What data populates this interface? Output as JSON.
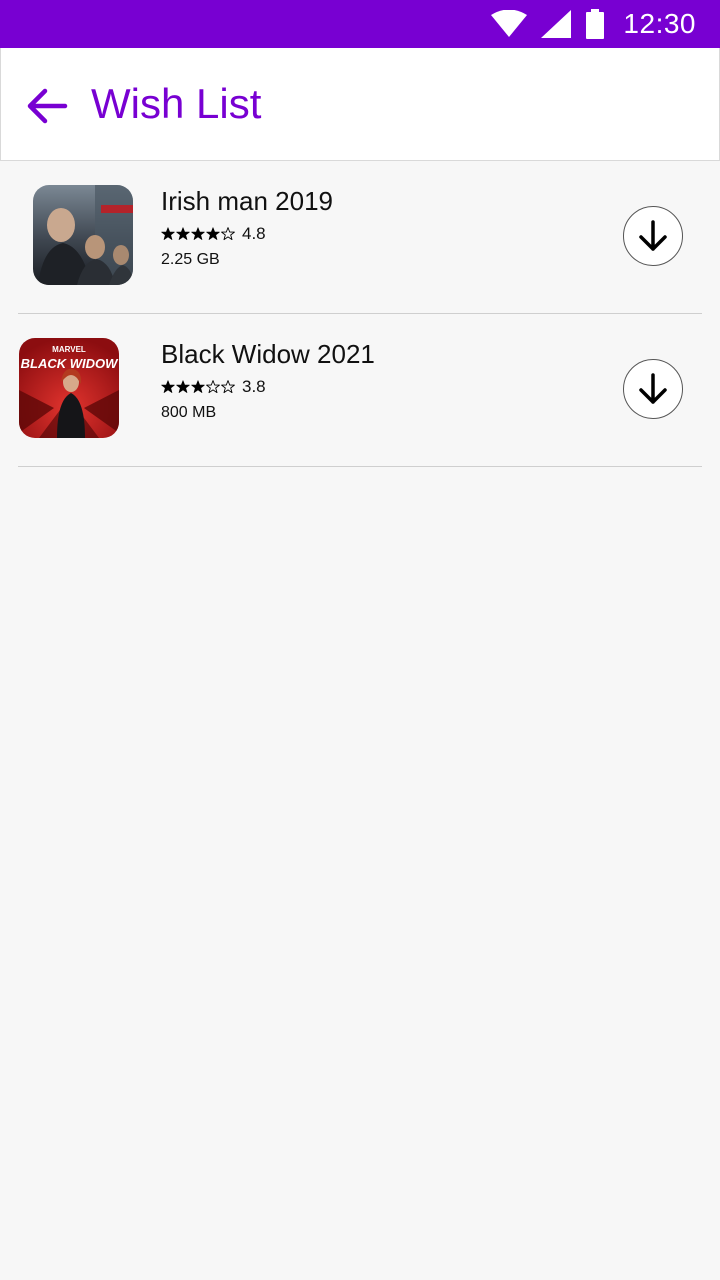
{
  "status_bar": {
    "time": "12:30",
    "icons": [
      "wifi-icon",
      "signal-icon",
      "battery-icon"
    ],
    "color": "#7800d2"
  },
  "header": {
    "title": "Wish List",
    "back_icon": "arrow-left-icon",
    "accent": "#7800d2"
  },
  "wishlist": {
    "items": [
      {
        "title": "Irish man 2019",
        "rating": "4.8",
        "stars_filled": 4,
        "stars_total": 5,
        "size": "2.25 GB",
        "poster_icon": "irishman-poster",
        "action_icon": "download-icon"
      },
      {
        "title": "Black Widow 2021",
        "rating": "3.8",
        "stars_filled": 3,
        "stars_total": 5,
        "size": "800 MB",
        "poster_icon": "black-widow-poster",
        "poster_text": "BLACK WIDOW",
        "poster_brand": "MARVEL",
        "action_icon": "download-icon"
      }
    ]
  }
}
